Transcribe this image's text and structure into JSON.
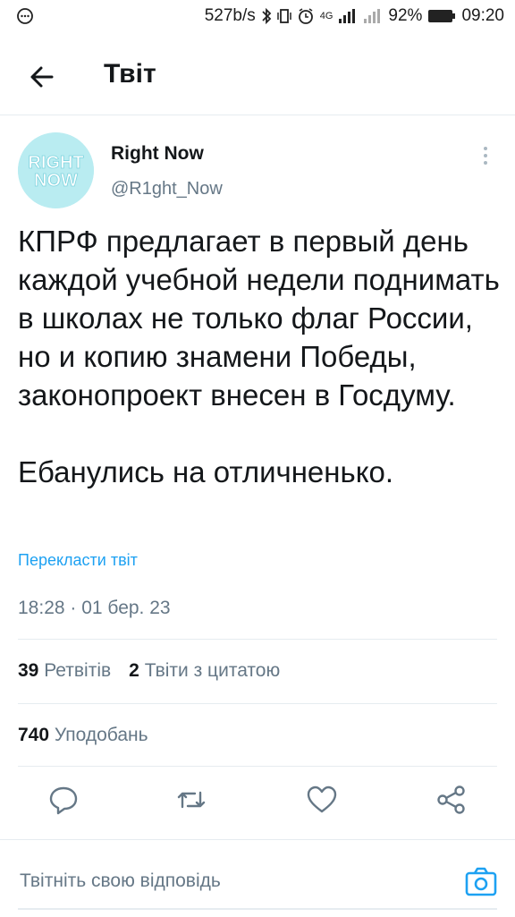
{
  "status_bar": {
    "speed": "527b/s",
    "battery": "92%",
    "time": "09:20",
    "network": "4G",
    "icons": [
      "chat-bubble-icon",
      "bluetooth-icon",
      "vibrate-icon",
      "alarm-icon",
      "signal-icon",
      "battery-icon"
    ]
  },
  "header": {
    "title": "Твіт"
  },
  "tweet": {
    "author_name": "Right Now",
    "author_handle": "@R1ght_Now",
    "avatar_text": [
      "RIGHT",
      "NOW"
    ],
    "text_paragraph1": "КПРФ предлагает в первый день каждой учебной недели поднимать в школах не только флаг России, но и копию знамени Победы, законопроект внесен в Госдуму.",
    "text_paragraph2": "Ебанулись на отличненько.",
    "translate_label": "Перекласти твіт",
    "timestamp": "18:28 · 01 бер. 23"
  },
  "stats": {
    "retweets_count": "39",
    "retweets_label": "Ретвітів",
    "quotes_count": "2",
    "quotes_label": "Твіти з цитатою",
    "likes_count": "740",
    "likes_label": "Уподобань"
  },
  "actions": [
    "reply-icon",
    "retweet-icon",
    "like-icon",
    "share-icon"
  ],
  "reply": {
    "placeholder": "Твітніть свою відповідь"
  },
  "colors": {
    "accent": "#1da1f2",
    "secondary_text": "#657786",
    "avatar_bg": "#b9ecf1"
  }
}
